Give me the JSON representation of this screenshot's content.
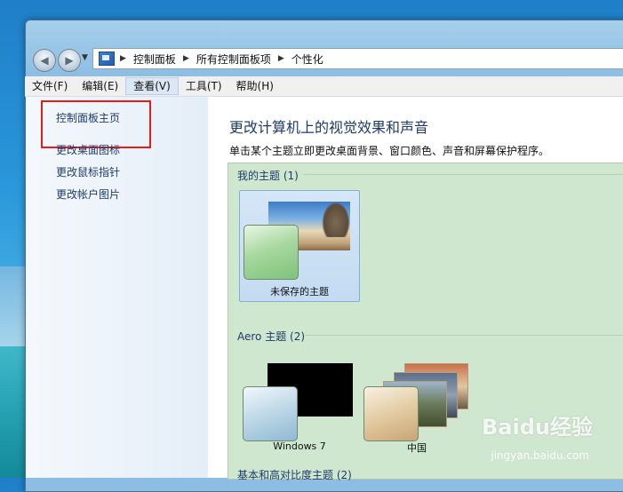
{
  "window": {
    "breadcrumb": [
      "控制面板",
      "所有控制面板项",
      "个性化"
    ]
  },
  "menu": {
    "items": [
      "文件(F)",
      "编辑(E)",
      "查看(V)",
      "工具(T)",
      "帮助(H)"
    ]
  },
  "sidebar": {
    "links": [
      "控制面板主页",
      "更改桌面图标",
      "更改鼠标指针",
      "更改帐户图片"
    ]
  },
  "content": {
    "title": "更改计算机上的视觉效果和声音",
    "description": "单击某个主题立即更改桌面背景、窗口颜色、声音和屏幕保护程序。",
    "sections": [
      {
        "heading": "我的主题 (1)",
        "themes": [
          "未保存的主题"
        ]
      },
      {
        "heading": "Aero 主题 (2)",
        "themes": [
          "Windows 7",
          "中国"
        ]
      },
      {
        "heading": "基本和高对比度主题 (2)"
      }
    ]
  },
  "watermark": {
    "brand": "Baidu经验",
    "url": "jingyan.baidu.com"
  },
  "colors": {
    "highlight": "#e81b1b",
    "theme_panel": "#cfe6cf",
    "link": "#1e3b6b"
  }
}
